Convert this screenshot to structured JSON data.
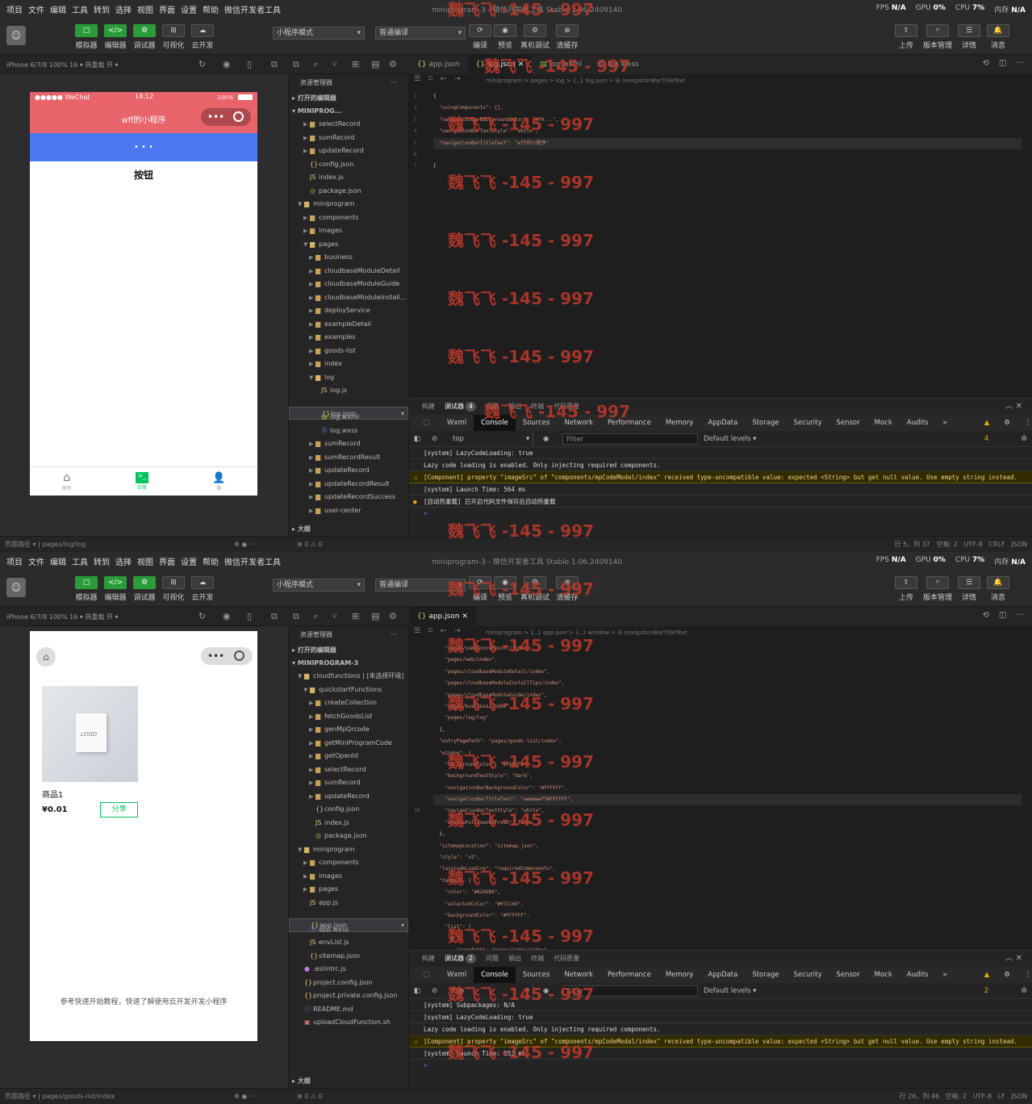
{
  "menu": [
    "项目",
    "文件",
    "编辑",
    "工具",
    "转到",
    "选择",
    "视图",
    "界面",
    "设置",
    "帮助",
    "微信开发者工具"
  ],
  "window_title": "miniprogram-3 - 微信开发者工具 Stable 1.06.2409140",
  "stats": {
    "fps_label": "FPS",
    "fps": "N/A",
    "gpu_label": "GPU",
    "gpu": "0%",
    "cpu_label": "CPU",
    "cpu1": "7%",
    "cpu2": "0%",
    "mem_label": "内存",
    "mem": "N/A"
  },
  "toolbar": {
    "sim": "模拟器",
    "editor": "编辑器",
    "debugger": "调试器",
    "visual": "可视化",
    "cloud": "云开发",
    "mode": "小程序模式",
    "compile_mode": "普通编译",
    "compile": "编译",
    "preview": "预览",
    "realdebug": "真机调试",
    "clearcache": "清缓存",
    "upload": "上传",
    "version": "版本管理",
    "details": "详情",
    "messages": "消息"
  },
  "device": "iPhone 6/7/8 100% 16 ▾",
  "hotreload": "热重载 开 ▾",
  "top": {
    "phone": {
      "carrier": "●●●●● WeChat",
      "time": "18:12",
      "battery": "100%",
      "nav_title": "wff的小程序",
      "button": "按钮",
      "tabbar": [
        "首页",
        "日常",
        "我"
      ]
    },
    "explorer_title": "资源管理器",
    "open_editors": "打开的编辑器",
    "project": "MINIPROG...",
    "tree": [
      {
        "d": 2,
        "t": "folder",
        "n": "selectRecord"
      },
      {
        "d": 2,
        "t": "folder",
        "n": "sumRecord"
      },
      {
        "d": 2,
        "t": "folder",
        "n": "updateRecord"
      },
      {
        "d": 2,
        "t": "json",
        "n": "config.json"
      },
      {
        "d": 2,
        "t": "js",
        "n": "index.js"
      },
      {
        "d": 2,
        "t": "pkg",
        "n": "package.json"
      },
      {
        "d": 1,
        "t": "folderopen",
        "n": "miniprogram"
      },
      {
        "d": 2,
        "t": "folder",
        "n": "components"
      },
      {
        "d": 2,
        "t": "folder",
        "n": "images"
      },
      {
        "d": 2,
        "t": "folderopen",
        "n": "pages"
      },
      {
        "d": 3,
        "t": "folder",
        "n": "business"
      },
      {
        "d": 3,
        "t": "folder",
        "n": "cloudbaseModuleDetail"
      },
      {
        "d": 3,
        "t": "folder",
        "n": "cloudbaseModuleGuide"
      },
      {
        "d": 3,
        "t": "folder",
        "n": "cloudbaseModuleInstall..."
      },
      {
        "d": 3,
        "t": "folder",
        "n": "deployService"
      },
      {
        "d": 3,
        "t": "folder",
        "n": "exampleDetail"
      },
      {
        "d": 3,
        "t": "folder",
        "n": "examples"
      },
      {
        "d": 3,
        "t": "folder",
        "n": "goods-list"
      },
      {
        "d": 3,
        "t": "folder",
        "n": "index"
      },
      {
        "d": 3,
        "t": "folderopen",
        "n": "log"
      },
      {
        "d": 4,
        "t": "js",
        "n": "log.js"
      },
      {
        "d": 4,
        "t": "json",
        "n": "log.json",
        "sel": true
      },
      {
        "d": 4,
        "t": "wxml",
        "n": "log.wxml"
      },
      {
        "d": 4,
        "t": "wxss",
        "n": "log.wxss"
      },
      {
        "d": 3,
        "t": "folder",
        "n": "sumRecord"
      },
      {
        "d": 3,
        "t": "folder",
        "n": "sumRecordResult"
      },
      {
        "d": 3,
        "t": "folder",
        "n": "updateRecord"
      },
      {
        "d": 3,
        "t": "folder",
        "n": "updateRecordResult"
      },
      {
        "d": 3,
        "t": "folder",
        "n": "updateRecordSuccess"
      },
      {
        "d": 3,
        "t": "folder",
        "n": "user-center"
      }
    ],
    "outline": "大纲",
    "problems": "⊗ 0 ⚠ 0",
    "tabs": [
      "app.json",
      "log.json",
      "log.wxml",
      "log.wxss"
    ],
    "breadcrumb": "miniprogram > pages > log > {..} log.json > ⊟ navigationBarTitleText",
    "gutter": [
      "1",
      "2",
      "3",
      "4",
      "5",
      "6",
      "7"
    ],
    "code": [
      "{",
      "  \"usingComponents\": {},",
      "  \"navigationBarBackgroundColor\": \"#f0...\",",
      "  \"navigationBarTextStyle\": \"white\",",
      "  \"navigationBarTitleText\": \"wff的小程序\"",
      "",
      "}"
    ],
    "dt_tabs": [
      "构建",
      "调试器",
      "4",
      "问题",
      "输出",
      "终端",
      "代码质量"
    ],
    "panels": [
      "Wxml",
      "Console",
      "Sources",
      "Network",
      "Performance",
      "Memory",
      "AppData",
      "Storage",
      "Security",
      "Sensor",
      "Mock",
      "Audits",
      "»"
    ],
    "warn_count": "▲ 4",
    "context": "top",
    "filter": "Filter",
    "levels": "Default levels ▾",
    "logs": [
      {
        "c": "",
        "t": "[system] LazyCodeLoading: true"
      },
      {
        "c": "",
        "t": "Lazy code loading is enabled. Only injecting required components."
      },
      {
        "c": "warn",
        "t": "[Component] property \"imageSrc\" of \"components/mpCodeModal/index\" received type-uncompatible value: expected <String> but get null value. Use empty string instead."
      },
      {
        "c": "",
        "t": "[system] Launch Time: 564 ms"
      },
      {
        "c": "info",
        "t": "[自动热重载] 已开启代码文件保存后自动热重载"
      },
      {
        "c": "",
        "t": ">"
      }
    ],
    "status_left": "页面路径 ▾ | pages/log/log",
    "status_right": "行 5，列 37   空格: 2   UTF-8   CRLF   JSON"
  },
  "bottom": {
    "phone": {
      "product": "商品1",
      "price": "¥0.01",
      "share": "分享",
      "footer": "参考快速开始教程，快速了解使用云开发开发小程序",
      "logo": "LOGO"
    },
    "explorer_title": "资源管理器",
    "open_editors": "打开的编辑器",
    "project": "MINIPROGRAM-3",
    "tree": [
      {
        "d": 1,
        "t": "folderopen",
        "n": "cloudfunctions | [未选择环境]"
      },
      {
        "d": 2,
        "t": "folderopen",
        "n": "quickstartFunctions"
      },
      {
        "d": 3,
        "t": "folder",
        "n": "createCollection"
      },
      {
        "d": 3,
        "t": "folder",
        "n": "fetchGoodsList"
      },
      {
        "d": 3,
        "t": "folder",
        "n": "genMpQrcode"
      },
      {
        "d": 3,
        "t": "folder",
        "n": "getMiniProgramCode"
      },
      {
        "d": 3,
        "t": "folder",
        "n": "getOpenId"
      },
      {
        "d": 3,
        "t": "folder",
        "n": "selectRecord"
      },
      {
        "d": 3,
        "t": "folder",
        "n": "sumRecord"
      },
      {
        "d": 3,
        "t": "folder",
        "n": "updateRecord"
      },
      {
        "d": 3,
        "t": "json",
        "n": "config.json"
      },
      {
        "d": 3,
        "t": "js",
        "n": "index.js"
      },
      {
        "d": 3,
        "t": "pkg",
        "n": "package.json"
      },
      {
        "d": 1,
        "t": "folderopen",
        "n": "miniprogram"
      },
      {
        "d": 2,
        "t": "folder",
        "n": "components"
      },
      {
        "d": 2,
        "t": "folder",
        "n": "images"
      },
      {
        "d": 2,
        "t": "folder",
        "n": "pages"
      },
      {
        "d": 2,
        "t": "js",
        "n": "app.js"
      },
      {
        "d": 2,
        "t": "json",
        "n": "app.json",
        "sel": true
      },
      {
        "d": 2,
        "t": "wxss",
        "n": "app.wxss"
      },
      {
        "d": 2,
        "t": "js",
        "n": "envList.js"
      },
      {
        "d": 2,
        "t": "json",
        "n": "sitemap.json"
      },
      {
        "d": 1,
        "t": "dot",
        "n": ".eslintrc.js"
      },
      {
        "d": 1,
        "t": "json",
        "n": "project.config.json"
      },
      {
        "d": 1,
        "t": "json",
        "n": "project.private.config.json"
      },
      {
        "d": 1,
        "t": "info",
        "n": "README.md"
      },
      {
        "d": 1,
        "t": "sh",
        "n": "uploadCloudFunction.sh"
      }
    ],
    "outline": "大纲",
    "problems": "⊗ 0 ⚠ 0",
    "tabs": [
      "app.json"
    ],
    "breadcrumb": "miniprogram > {..} app.json > {..} window > ⊟ navigationBarTitleText",
    "gutter": [
      "",
      "",
      "",
      "",
      "",
      "",
      "",
      "",
      "",
      "",
      "",
      "",
      "",
      "",
      "26",
      "",
      "",
      "",
      "",
      "",
      "",
      "",
      "",
      "",
      "",
      "",
      "",
      "",
      ""
    ],
    "code": [
      "    \"pages/sumRecordResult/index\",",
      "    \"pages/web/index\",",
      "    \"pages/cloudbaseModuleDetail/index\",",
      "    \"pages/cloudbaseModuleInstallTips/index\",",
      "    \"pages/cloudbaseModuleGuide/index\",",
      "    \"pages/business/index\",",
      "    \"pages/log/log\"",
      "  ],",
      "  \"entryPagePath\": \"pages/goods-list/index\",",
      "  \"window\": {",
      "    \"backgroundColor\": \"#F6F6F6\",",
      "    \"backgroundTextStyle\": \"dark\",",
      "    \"navigationBarBackgroundColor\": \"#FFFFFF\",",
      "    \"navigationBarTitleText\": \"wwwwwwff#FFFFFF\",",
      "    \"navigationBarTextStyle\": \"white\",",
      "    \"enablePullDownRefresh\": false",
      "  },",
      "  \"sitemapLocation\": \"sitemap.json\",",
      "  \"style\": \"v2\",",
      "  \"lazyCodeLoading\": \"requiredComponents\",",
      "  \"tabBar\": {",
      "    \"color\": \"#A2A9B0\",",
      "    \"selectedColor\": \"#07C160\",",
      "    \"backgroundColor\": \"#FFFFFF\",",
      "    \"list\": [",
      "      {",
      "        \"pagePath\": \"pages/index/index\","
    ],
    "dt_tabs": [
      "构建",
      "调试器",
      "2",
      "问题",
      "输出",
      "终端",
      "代码质量"
    ],
    "panels": [
      "Wxml",
      "Console",
      "Sources",
      "Network",
      "Performance",
      "Memory",
      "AppData",
      "Storage",
      "Security",
      "Sensor",
      "Mock",
      "Audits",
      "»"
    ],
    "warn_count": "▲ 2",
    "context": "top",
    "filter": "Filter",
    "levels": "Default levels ▾",
    "logs": [
      {
        "c": "",
        "t": "[system] Subpackages: N/A"
      },
      {
        "c": "",
        "t": "[system] LazyCodeLoading: true"
      },
      {
        "c": "",
        "t": "Lazy code loading is enabled. Only injecting required components."
      },
      {
        "c": "warn",
        "t": "[Component] property \"imageSrc\" of \"components/mpCodeModal/index\" received type-uncompatible value: expected <String> but get null value. Use empty string instead."
      },
      {
        "c": "",
        "t": "[system] Launch Time: 553 ms"
      },
      {
        "c": "",
        "t": ">"
      }
    ],
    "status_left": "页面路径 ▾ | pages/goods-list/index",
    "status_right": "行 26，列 46   空格: 2   UTF-8   LF   JSON"
  },
  "watermark": "魏飞飞 -145 - 997",
  "colors": {
    "nav_red": "#e8636a",
    "blue_bar": "#4a78f0",
    "green": "#2a9d3a",
    "share_green": "#07c160"
  }
}
